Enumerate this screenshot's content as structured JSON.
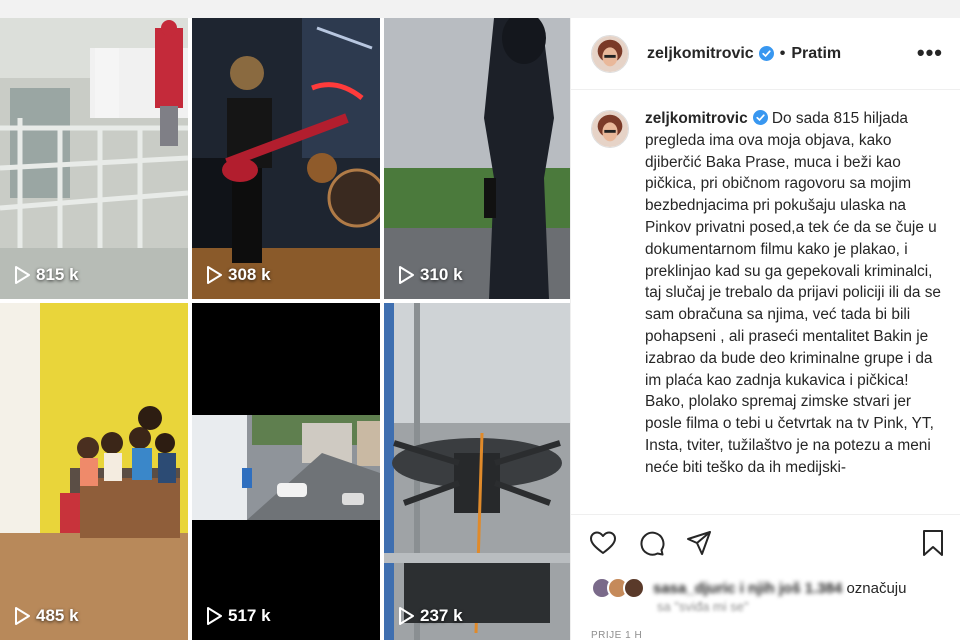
{
  "profile": {
    "username": "zeljkomitrovic",
    "follow_label": "Pratim",
    "separator": "•",
    "more_label": "•••"
  },
  "grid": [
    {
      "views": "815 k",
      "scene": "street"
    },
    {
      "views": "308 k",
      "scene": "guitar-studio"
    },
    {
      "views": "310 k",
      "scene": "hooded-figure"
    },
    {
      "views": "485 k",
      "scene": "kids-room"
    },
    {
      "views": "517 k",
      "scene": "street-aerial"
    },
    {
      "views": "237 k",
      "scene": "drone"
    }
  ],
  "caption": {
    "username": "zeljkomitrovic",
    "text": "Do sada 815 hiljada pregleda ima ova moja objava, kako djiberčić Baka Prase, muca i beži kao pičkica, pri običnom ragovoru sa mojim bezbednjacima pri pokušaju ulaska na Pinkov privatni posed,a tek će da se čuje u dokumentarnom filmu kako je plakao, i preklinjao kad su ga gepekovali kriminalci, taj slučaj je trebalo da prijavi policiji ili da se sam obračuna sa njima, već tada bi bili pohapseni , ali praseći mentalitet Bakin je izabrao da bude deo kriminalne grupe i da im plaća kao zadnja kukavica i pičkica! Bako, plolako spremaj zimske stvari jer posle filma o tebi u četvrtak na tv Pink, YT, Insta, tviter, tužilaštvo je na potezu a meni neće biti teško da ih medijski-"
  },
  "likes": {
    "names": "sasa_djuric i njih još 1.384",
    "suffix": "označuju",
    "sub": "sa \"sviđa mi se\""
  },
  "time_label": "PRIJE 1 H",
  "icons": [
    "heart-icon",
    "comment-icon",
    "share-icon",
    "bookmark-icon",
    "verified-icon",
    "play-icon",
    "more-icon"
  ],
  "colors": {
    "verified": "#3897f0",
    "text": "#262626",
    "muted": "#8e8e8e"
  }
}
